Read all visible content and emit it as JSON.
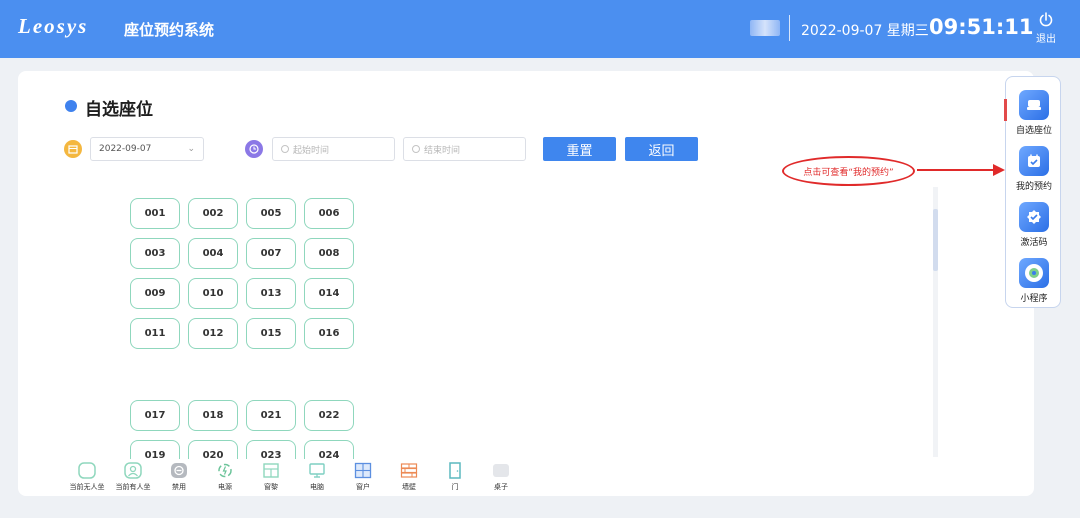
{
  "header": {
    "brand": "Leosys",
    "app_title": "座位预约系统",
    "date": "2022-09-07 星期三",
    "time": "09:51:11",
    "logout_label": "退出"
  },
  "page": {
    "title": "自选座位",
    "date_value": "2022-09-07",
    "start_time_placeholder": "起始时间",
    "end_time_placeholder": "结束时间",
    "reset_label": "重置",
    "back_label": "返回"
  },
  "annotation": {
    "text": "点击可查看“我的预约”"
  },
  "seats": [
    {
      "label": "001",
      "col": 0,
      "row": 0
    },
    {
      "label": "002",
      "col": 1,
      "row": 0
    },
    {
      "label": "005",
      "col": 2,
      "row": 0
    },
    {
      "label": "006",
      "col": 3,
      "row": 0
    },
    {
      "label": "003",
      "col": 0,
      "row": 1
    },
    {
      "label": "004",
      "col": 1,
      "row": 1
    },
    {
      "label": "007",
      "col": 2,
      "row": 1
    },
    {
      "label": "008",
      "col": 3,
      "row": 1
    },
    {
      "label": "009",
      "col": 0,
      "row": 2
    },
    {
      "label": "010",
      "col": 1,
      "row": 2
    },
    {
      "label": "013",
      "col": 2,
      "row": 2
    },
    {
      "label": "014",
      "col": 3,
      "row": 2
    },
    {
      "label": "011",
      "col": 0,
      "row": 3
    },
    {
      "label": "012",
      "col": 1,
      "row": 3
    },
    {
      "label": "015",
      "col": 2,
      "row": 3
    },
    {
      "label": "016",
      "col": 3,
      "row": 3
    },
    {
      "label": "017",
      "col": 0,
      "row": 4
    },
    {
      "label": "018",
      "col": 1,
      "row": 4
    },
    {
      "label": "021",
      "col": 2,
      "row": 4
    },
    {
      "label": "022",
      "col": 3,
      "row": 4
    },
    {
      "label": "019",
      "col": 0,
      "row": 5
    },
    {
      "label": "020",
      "col": 1,
      "row": 5
    },
    {
      "label": "023",
      "col": 2,
      "row": 5
    },
    {
      "label": "024",
      "col": 3,
      "row": 5
    }
  ],
  "legend": [
    {
      "label": "当前无人坐",
      "icon": "empty-seat-icon"
    },
    {
      "label": "当前有人坐",
      "icon": "occupied-seat-icon"
    },
    {
      "label": "禁用",
      "icon": "disabled-icon"
    },
    {
      "label": "电源",
      "icon": "power-icon"
    },
    {
      "label": "窗黎",
      "icon": "window-icon"
    },
    {
      "label": "电脑",
      "icon": "computer-icon"
    },
    {
      "label": "窗户",
      "icon": "window-frame-icon"
    },
    {
      "label": "墙壁",
      "icon": "wall-icon"
    },
    {
      "label": "门",
      "icon": "door-icon"
    },
    {
      "label": "桌子",
      "icon": "table-icon"
    }
  ],
  "sidebar": {
    "items": [
      {
        "label": "自选座位",
        "icon": "seat-icon"
      },
      {
        "label": "我的预约",
        "icon": "calendar-check-icon"
      },
      {
        "label": "激活码",
        "icon": "badge-check-icon"
      },
      {
        "label": "小程序",
        "icon": "miniprogram-icon"
      }
    ]
  },
  "colors": {
    "header_bg": "#4b8ff0",
    "accent": "#3f86ee",
    "seat_border": "#8fd7bd",
    "annotation": "#e02a2a"
  }
}
